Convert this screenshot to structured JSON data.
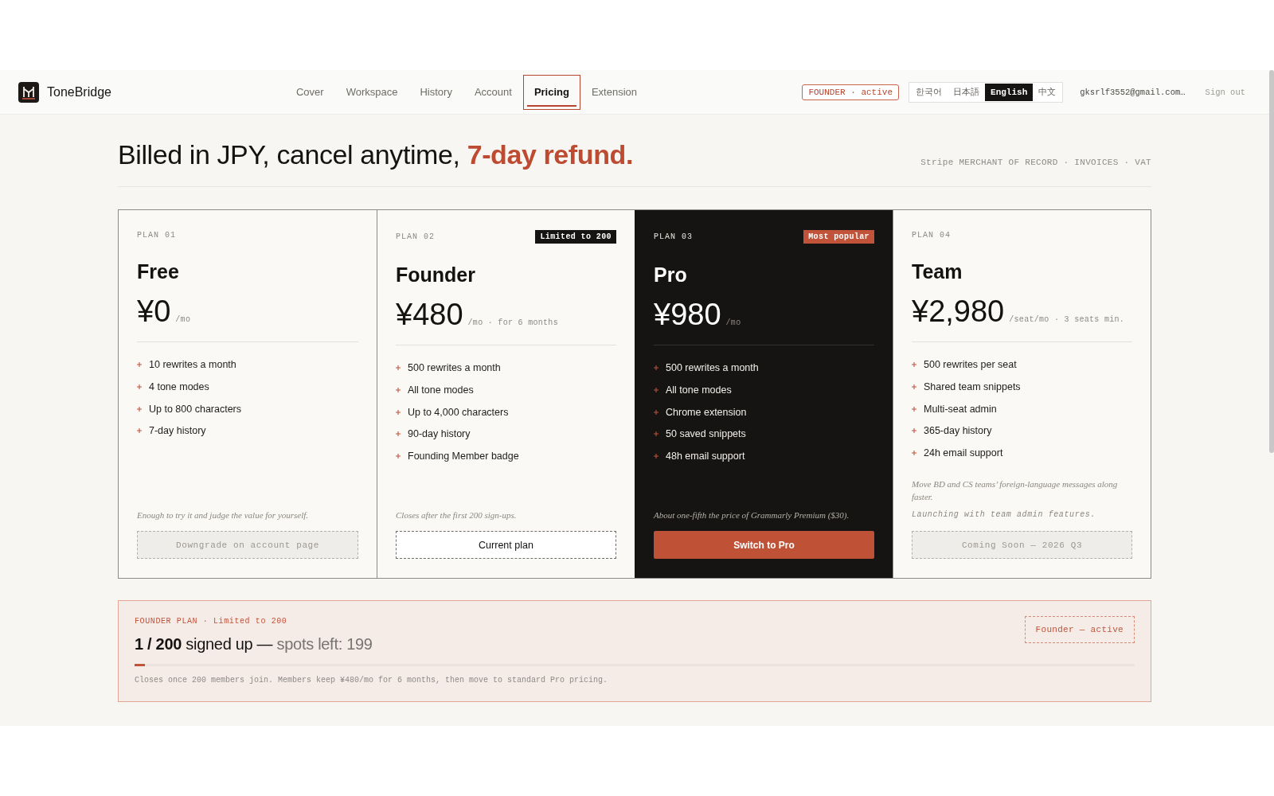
{
  "header": {
    "brand": "ToneBridge",
    "nav": [
      {
        "label": "Cover",
        "selected": false
      },
      {
        "label": "Workspace",
        "selected": false
      },
      {
        "label": "History",
        "selected": false
      },
      {
        "label": "Account",
        "selected": false
      },
      {
        "label": "Pricing",
        "selected": true
      },
      {
        "label": "Extension",
        "selected": false
      }
    ],
    "plan_badge": "FOUNDER · active",
    "languages": [
      {
        "label": "한국어",
        "selected": false
      },
      {
        "label": "日本語",
        "selected": false
      },
      {
        "label": "English",
        "selected": true
      },
      {
        "label": "中文",
        "selected": false
      }
    ],
    "email": "gksrlf3552@gmail.com…",
    "sign_out": "Sign out"
  },
  "hero": {
    "title": "Billed in JPY, cancel anytime, **7-day refund.**",
    "billing_note": "Stripe MERCHANT OF RECORD · INVOICES · VAT"
  },
  "plans": [
    {
      "plan_label": "PLAN 01",
      "highlighted": false,
      "name": "Free",
      "price": "¥0",
      "price_suffix": "/mo",
      "features": [
        "10 rewrites a month",
        "4 tone modes",
        "Up to 800 characters",
        "7-day history"
      ],
      "notes": [
        {
          "kind": "serif",
          "text": "Enough to try it and judge the value for yourself."
        }
      ],
      "button": {
        "kind": "disabled",
        "label": "Downgrade on account page"
      }
    },
    {
      "plan_label": "PLAN 02",
      "badge": "Limited to 200",
      "highlighted": false,
      "name": "Founder",
      "price": "¥480",
      "price_suffix": "/mo · for 6 months",
      "features": [
        "500 rewrites a month",
        "All tone modes",
        "Up to 4,000 characters",
        "90-day history",
        "Founding Member badge"
      ],
      "notes": [
        {
          "kind": "serif",
          "text": "Closes after the first 200 sign-ups."
        }
      ],
      "button": {
        "kind": "current",
        "label": "Current plan"
      }
    },
    {
      "plan_label": "PLAN 03",
      "badge": "Most popular",
      "highlighted": true,
      "name": "Pro",
      "price": "¥980",
      "price_suffix": "/mo",
      "features": [
        "500 rewrites a month",
        "All tone modes",
        "Chrome extension",
        "50 saved snippets",
        "48h email support"
      ],
      "notes": [
        {
          "kind": "serif",
          "text": "About one-fifth the price of Grammarly Premium ($30)."
        }
      ],
      "button": {
        "kind": "primary",
        "label": "Switch to Pro"
      }
    },
    {
      "plan_label": "PLAN 04",
      "highlighted": false,
      "name": "Team",
      "price": "¥2,980",
      "price_suffix": "/seat/mo · 3 seats min.",
      "features": [
        "500 rewrites per seat",
        "Shared team snippets",
        "Multi-seat admin",
        "365-day history",
        "24h email support"
      ],
      "notes": [
        {
          "kind": "serif",
          "text": "Move BD and CS teams’ foreign-language messages along faster."
        },
        {
          "kind": "mono",
          "text": "Launching with team admin features."
        }
      ],
      "button": {
        "kind": "disabled",
        "label": "Coming Soon — 2026 Q3"
      }
    }
  ],
  "founder_banner": {
    "eyebrow": "FOUNDER PLAN · Limited to 200",
    "signups": "**1 / 200** signed up —",
    "spots_left": "spots left: 199",
    "progress": {
      "level": 0.01
    },
    "footnote": "Closes once 200 members join. Members keep ¥480/mo for 6 months, then move to standard Pro pricing.",
    "status": "Founder — active"
  }
}
